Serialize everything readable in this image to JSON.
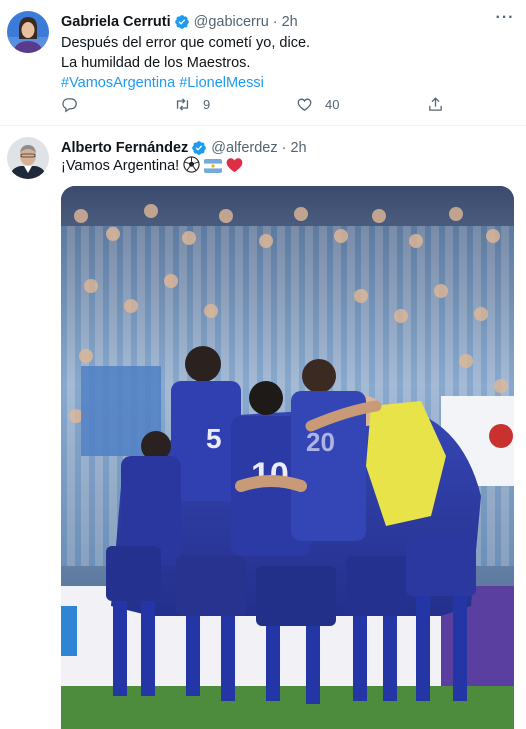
{
  "tweets": [
    {
      "author": {
        "name": "Gabriela Cerruti",
        "handle": "@gabicerru",
        "verified": true
      },
      "time": "2h",
      "text_lines": [
        "Después del error que cometí yo, dice.",
        "La humildad de los Maestros."
      ],
      "hashtags": [
        "#VamosArgentina",
        "#LionelMessi"
      ],
      "actions": {
        "reply": "",
        "retweets": "9",
        "likes": "40"
      }
    },
    {
      "author": {
        "name": "Alberto Fernández",
        "handle": "@alferdez",
        "verified": true
      },
      "time": "2h",
      "text": "¡Vamos Argentina!",
      "emojis": [
        "soccer-ball",
        "argentina-flag",
        "red-heart"
      ],
      "media": {
        "type": "photo",
        "subject": "team-celebration"
      }
    }
  ],
  "colors": {
    "accent": "#1d9bf0",
    "secondary_text": "#536471",
    "primary_text": "#0f1419",
    "divider": "#eff3f4",
    "kit_blue": "#2b3aa8",
    "goalkeeper_yellow": "#e9e34a"
  },
  "separator": "·"
}
